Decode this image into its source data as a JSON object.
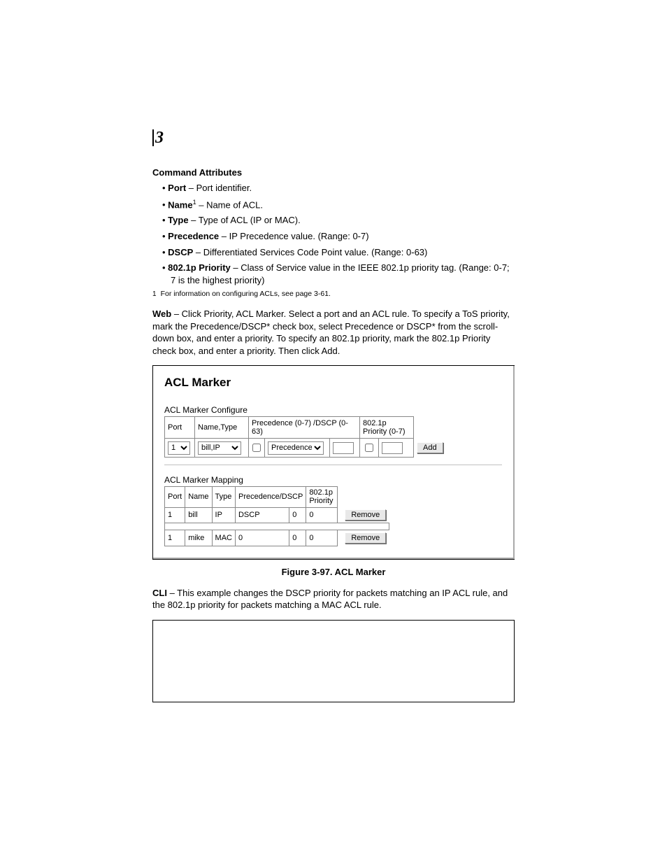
{
  "chapter": "3",
  "section_head": "Command Attributes",
  "attrs": [
    {
      "label": "Port",
      "desc": " – Port identifier."
    },
    {
      "label": "Name",
      "sup": "1",
      "desc": " – Name of ACL."
    },
    {
      "label": "Type",
      "desc": " – Type of ACL (IP or MAC)."
    },
    {
      "label": "Precedence",
      "desc": " – IP Precedence value. (Range: 0-7)"
    },
    {
      "label": "DSCP",
      "desc": " – Differentiated Services Code Point value. (Range: 0-63)"
    },
    {
      "label": "802.1p Priority",
      "desc": " – Class of Service value in the IEEE 802.1p priority tag. (Range: 0-7; 7 is the highest priority)"
    }
  ],
  "footnote": {
    "num": "1",
    "text": "For information on configuring ACLs, see page 3-61."
  },
  "web_para_lead": "Web",
  "web_para": " – Click Priority, ACL Marker. Select a port and an ACL rule. To specify a ToS priority, mark the Precedence/DSCP* check box, select Precedence or DSCP* from the scroll-down box, and enter a priority. To specify an 802.1p priority, mark the 802.1p Priority check box, and enter a priority. Then click Add.",
  "shot": {
    "title": "ACL Marker",
    "configure": {
      "heading": "ACL Marker Configure",
      "headers": {
        "port": "Port",
        "name_type": "Name,Type",
        "prec": "Precedence (0-7) /DSCP (0-63)",
        "p8021": "802.1p Priority (0-7)"
      },
      "row": {
        "port_selected": "1",
        "name_type_selected": "bill,IP",
        "prec_selected": "Precedence",
        "add_btn": "Add"
      }
    },
    "mapping": {
      "heading": "ACL Marker Mapping",
      "headers": {
        "port": "Port",
        "name": "Name",
        "type": "Type",
        "prec": "Precedence/DSCP",
        "p8021": "802.1p Priority"
      },
      "rows": [
        {
          "port": "1",
          "name": "bill",
          "type": "IP",
          "prec_label": "DSCP",
          "prec_val": "0",
          "p8021": "0",
          "btn": "Remove"
        },
        {
          "port": "1",
          "name": "mike",
          "type": "MAC",
          "prec_label": "0",
          "prec_val": "0",
          "p8021": "0",
          "btn": "Remove"
        }
      ]
    }
  },
  "figure_caption": "Figure 3-97.  ACL Marker",
  "cli_para_lead": "CLI",
  "cli_para": " – This example changes the DSCP priority for packets matching an IP ACL rule, and the 802.1p priority for packets matching a MAC ACL rule."
}
